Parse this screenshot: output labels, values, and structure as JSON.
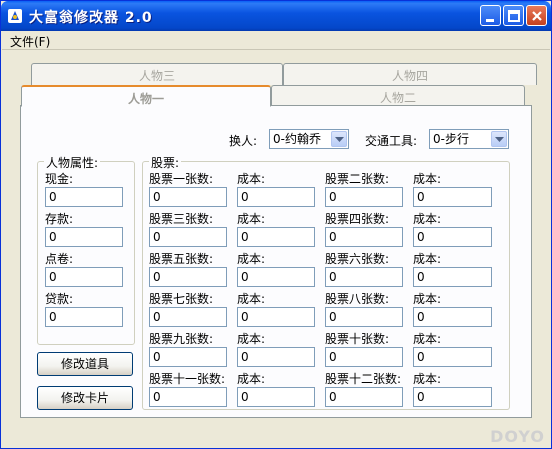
{
  "window": {
    "title": "大富翁修改器 2.0"
  },
  "menu": {
    "file": "文件(F)"
  },
  "tabs": [
    "人物三",
    "人物四",
    "人物一",
    "人物二"
  ],
  "selectors": {
    "person_label": "换人:",
    "person_value": "0-约翰乔",
    "vehicle_label": "交通工具:",
    "vehicle_value": "0-步行"
  },
  "attributes": {
    "title": "人物属性:",
    "fields": [
      {
        "label": "现金:",
        "value": "0"
      },
      {
        "label": "存款:",
        "value": "0"
      },
      {
        "label": "点卷:",
        "value": "0"
      },
      {
        "label": "贷款:",
        "value": "0"
      }
    ]
  },
  "stocks": {
    "title": "股票:",
    "cost_label": "成本:",
    "items": [
      {
        "label": "股票一张数:",
        "count": "0",
        "cost": "0"
      },
      {
        "label": "股票二张数:",
        "count": "0",
        "cost": "0"
      },
      {
        "label": "股票三张数:",
        "count": "0",
        "cost": "0"
      },
      {
        "label": "股票四张数:",
        "count": "0",
        "cost": "0"
      },
      {
        "label": "股票五张数:",
        "count": "0",
        "cost": "0"
      },
      {
        "label": "股票六张数:",
        "count": "0",
        "cost": "0"
      },
      {
        "label": "股票七张数:",
        "count": "0",
        "cost": "0"
      },
      {
        "label": "股票八张数:",
        "count": "0",
        "cost": "0"
      },
      {
        "label": "股票九张数:",
        "count": "0",
        "cost": "0"
      },
      {
        "label": "股票十张数:",
        "count": "0",
        "cost": "0"
      },
      {
        "label": "股票十一张数:",
        "count": "0",
        "cost": "0"
      },
      {
        "label": "股票十二张数:",
        "count": "0",
        "cost": "0"
      }
    ]
  },
  "buttons": {
    "modify_items": "修改道具",
    "modify_cards": "修改卡片"
  },
  "watermark": "DOYO"
}
